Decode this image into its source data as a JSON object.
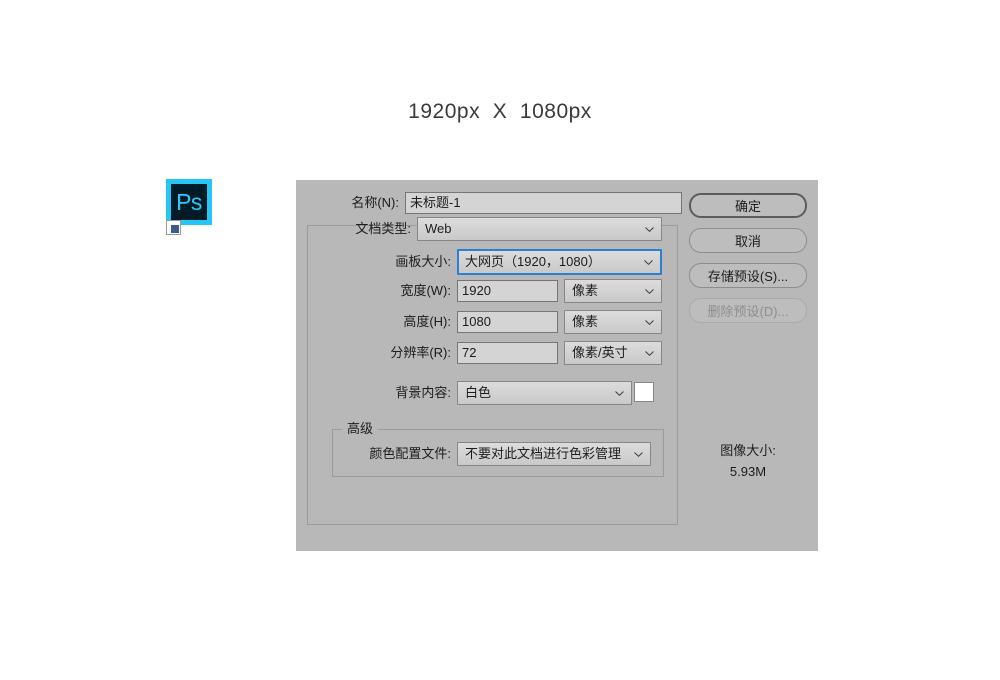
{
  "heading": "1920px  X  1080px",
  "desktop_icon": {
    "name": "Adobe Photoshop",
    "glyph": "Ps",
    "badge_color": "#25c5f5",
    "fill_color": "#021c27"
  },
  "dialog": {
    "fields": {
      "name": {
        "label": "名称(N):",
        "value": "未标题-1",
        "placeholder": "未标题-1"
      },
      "doc_type": {
        "label": "文档类型:",
        "value": "Web"
      },
      "artboard_size": {
        "label": "画板大小:",
        "value": "大网页（1920，1080）",
        "focused": true,
        "focus_color": "#2b7fd4"
      },
      "width": {
        "label": "宽度(W):",
        "value": "1920",
        "unit": "像素"
      },
      "height": {
        "label": "高度(H):",
        "value": "1080",
        "unit": "像素"
      },
      "resolution": {
        "label": "分辨率(R):",
        "value": "72",
        "unit": "像素/英寸"
      },
      "background_contents": {
        "label": "背景内容:",
        "value": "白色",
        "swatch_color": "#ffffff"
      }
    },
    "advanced": {
      "legend": "高级",
      "color_profile": {
        "label": "颜色配置文件:",
        "value": "不要对此文档进行色彩管理"
      }
    },
    "buttons": {
      "ok": "确定",
      "cancel": "取消",
      "save_preset": "存储预设(S)...",
      "delete_preset": "删除预设(D)..."
    },
    "image_size": {
      "label": "图像大小:",
      "value": "5.93M"
    }
  }
}
